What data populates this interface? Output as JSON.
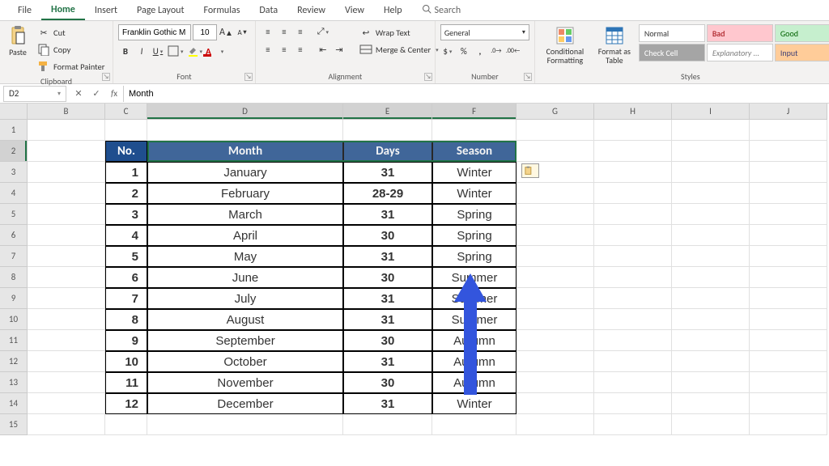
{
  "tabs": [
    "File",
    "Home",
    "Insert",
    "Page Layout",
    "Formulas",
    "Data",
    "Review",
    "View",
    "Help"
  ],
  "active_tab": "Home",
  "search_placeholder": "Search",
  "clipboard": {
    "paste": "Paste",
    "cut": "Cut",
    "copy": "Copy",
    "painter": "Format Painter",
    "label": "Clipboard"
  },
  "font": {
    "name": "Franklin Gothic M",
    "size": "10",
    "bold": "B",
    "italic": "I",
    "underline": "U",
    "label": "Font",
    "grow": "A",
    "shrink": "A"
  },
  "alignment": {
    "wrap": "Wrap Text",
    "merge": "Merge & Center",
    "label": "Alignment"
  },
  "number": {
    "format": "General",
    "label": "Number",
    "currency": "$",
    "percent": "%",
    "comma": ",",
    "inc": "←.0",
    "dec": ".00→"
  },
  "styles": {
    "cond": "Conditional Formatting",
    "table": "Format as Table",
    "normal": "Normal",
    "bad": "Bad",
    "good": "Good",
    "check": "Check Cell",
    "expl": "Explanatory ...",
    "input": "Input",
    "label": "Styles"
  },
  "namebox": "D2",
  "formula": "Month",
  "columns": [
    "",
    "B",
    "C",
    "D",
    "E",
    "F",
    "G",
    "H",
    "I",
    "J"
  ],
  "rows": [
    "1",
    "2",
    "3",
    "4",
    "5",
    "6",
    "7",
    "8",
    "9",
    "10",
    "11",
    "12",
    "13",
    "14",
    "15"
  ],
  "table": {
    "headers": {
      "no": "No.",
      "month": "Month",
      "days": "Days",
      "season": "Season"
    },
    "data": [
      {
        "no": "1",
        "month": "January",
        "days": "31",
        "season": "Winter"
      },
      {
        "no": "2",
        "month": "February",
        "days": "28-29",
        "season": "Winter"
      },
      {
        "no": "3",
        "month": "March",
        "days": "31",
        "season": "Spring"
      },
      {
        "no": "4",
        "month": "April",
        "days": "30",
        "season": "Spring"
      },
      {
        "no": "5",
        "month": "May",
        "days": "31",
        "season": "Spring"
      },
      {
        "no": "6",
        "month": "June",
        "days": "30",
        "season": "Summer"
      },
      {
        "no": "7",
        "month": "July",
        "days": "31",
        "season": "Summer"
      },
      {
        "no": "8",
        "month": "August",
        "days": "31",
        "season": "Summer"
      },
      {
        "no": "9",
        "month": "September",
        "days": "30",
        "season": "Autumn"
      },
      {
        "no": "10",
        "month": "October",
        "days": "31",
        "season": "Autumn"
      },
      {
        "no": "11",
        "month": "November",
        "days": "30",
        "season": "Autumn"
      },
      {
        "no": "12",
        "month": "December",
        "days": "31",
        "season": "Winter"
      }
    ]
  }
}
